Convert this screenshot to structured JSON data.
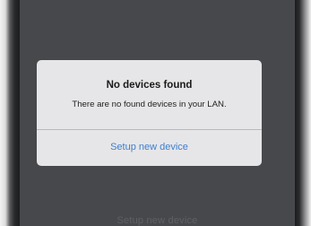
{
  "alert": {
    "title": "No devices found",
    "message": "There are no found devices in your LAN.",
    "action_label": "Setup new device"
  },
  "background": {
    "bottom_text": "Setup new device"
  },
  "colors": {
    "screen_dim": "#47484c",
    "dialog_bg": "#e6e6e8",
    "action_blue": "#3f7fd0"
  }
}
